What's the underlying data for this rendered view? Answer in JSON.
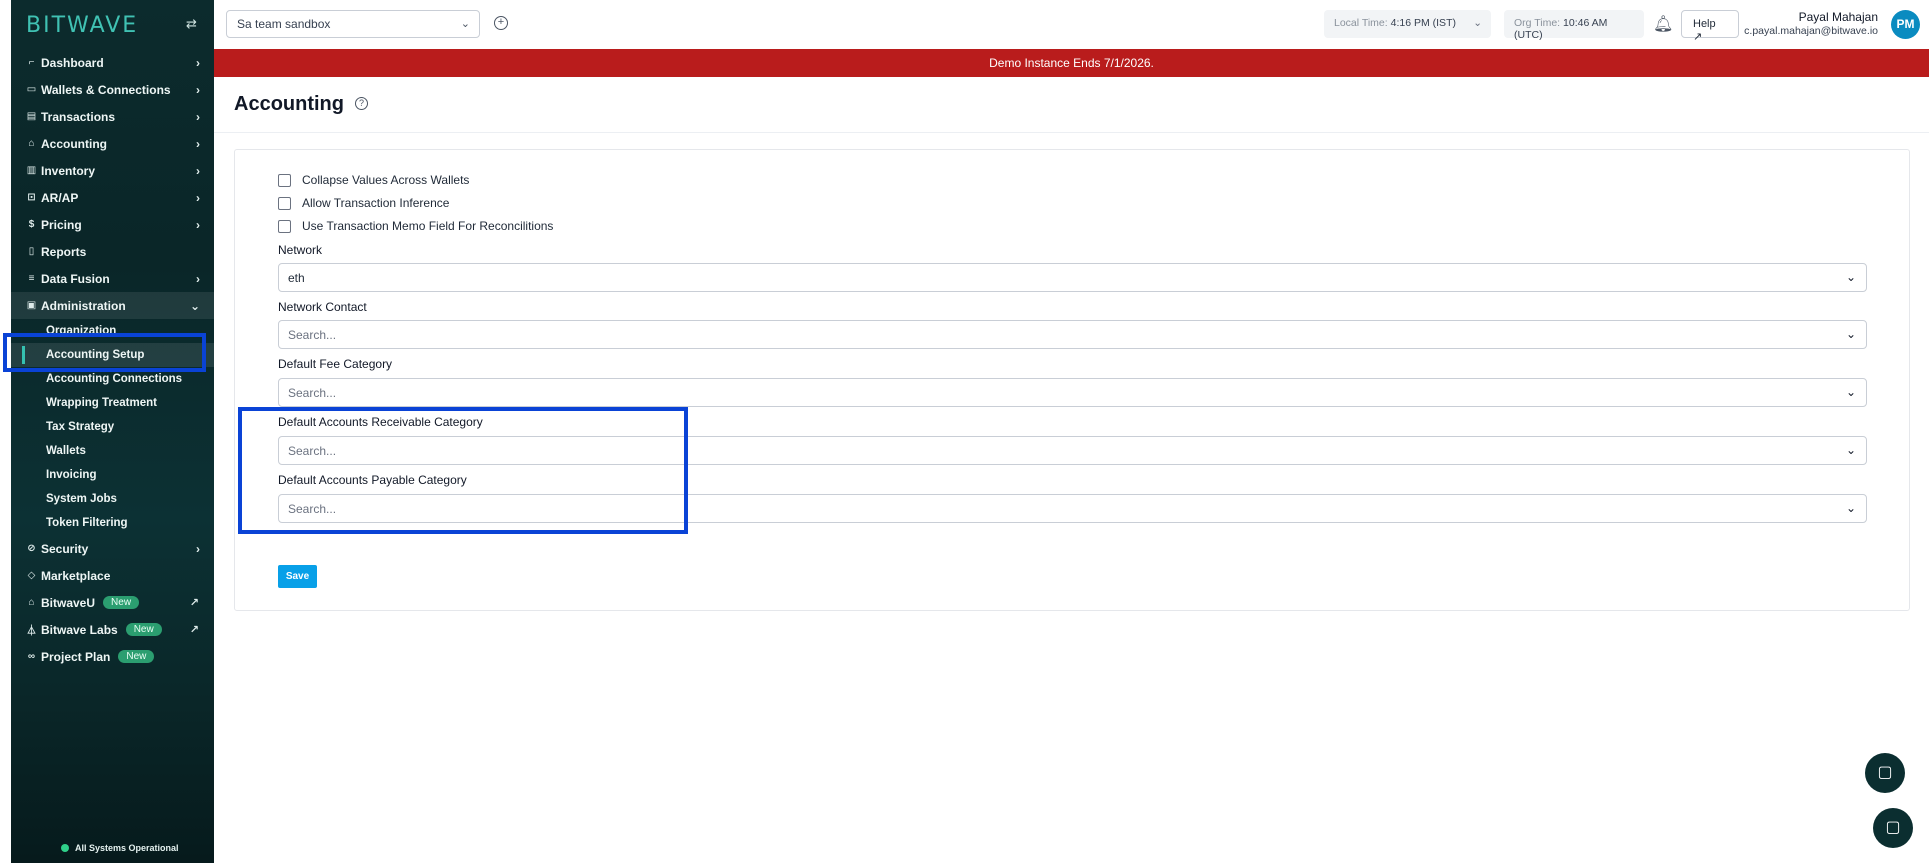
{
  "sidebar": {
    "brand": "BITWAVE",
    "items": [
      {
        "label": "Dashboard",
        "icon": "chart-line-icon",
        "glyph": "⌐"
      },
      {
        "label": "Wallets & Connections",
        "icon": "wallet-icon",
        "glyph": "▭"
      },
      {
        "label": "Transactions",
        "icon": "transactions-icon",
        "glyph": "▤"
      },
      {
        "label": "Accounting",
        "icon": "bank-icon",
        "glyph": "⌂"
      },
      {
        "label": "Inventory",
        "icon": "inventory-icon",
        "glyph": "▥"
      },
      {
        "label": "AR/AP",
        "icon": "invoice-icon",
        "glyph": "⊡"
      },
      {
        "label": "Pricing",
        "icon": "dollar-icon",
        "glyph": "$"
      },
      {
        "label": "Reports",
        "icon": "report-icon",
        "glyph": "▯"
      },
      {
        "label": "Data Fusion",
        "icon": "database-icon",
        "glyph": "≡"
      },
      {
        "label": "Administration",
        "icon": "admin-icon",
        "glyph": "▣"
      }
    ],
    "admin_sub": [
      "Organization",
      "Accounting Setup",
      "Accounting Connections",
      "Wrapping Treatment",
      "Tax Strategy",
      "Wallets",
      "Invoicing",
      "System Jobs",
      "Token Filtering"
    ],
    "bottom_items": [
      {
        "label": "Security",
        "icon": "shield-icon",
        "glyph": "⊘"
      },
      {
        "label": "Marketplace",
        "icon": "tag-icon",
        "glyph": "◇"
      },
      {
        "label": "BitwaveU",
        "icon": "graduation-cap-icon",
        "glyph": "⌂",
        "badge": "New"
      },
      {
        "label": "Bitwave Labs",
        "icon": "flask-icon",
        "glyph": "⏃",
        "badge": "New"
      },
      {
        "label": "Project Plan",
        "icon": "binoculars-icon",
        "glyph": "∞",
        "badge": "New"
      }
    ],
    "status": "All Systems Operational"
  },
  "topbar": {
    "org": "Sa team sandbox",
    "local_time_label": "Local Time:",
    "local_time": "4:16 PM (IST)",
    "org_time_label": "Org Time:",
    "org_time": "10:46 AM (UTC)",
    "help": "Help",
    "user_name": "Payal Mahajan",
    "user_email": "c.payal.mahajan@bitwave.io",
    "avatar": "PM"
  },
  "banner": "Demo Instance Ends 7/1/2026.",
  "page": {
    "title": "Accounting",
    "checkboxes": [
      "Collapse Values Across Wallets",
      "Allow Transaction Inference",
      "Use Transaction Memo Field For Reconcilitions"
    ],
    "fields": [
      {
        "label": "Network",
        "value": "eth"
      },
      {
        "label": "Network Contact",
        "placeholder": "Search..."
      },
      {
        "label": "Default Fee Category",
        "placeholder": "Search..."
      },
      {
        "label": "Default Accounts Receivable Category",
        "placeholder": "Search..."
      },
      {
        "label": "Default Accounts Payable Category",
        "placeholder": "Search..."
      }
    ],
    "save": "Save"
  },
  "colors": {
    "sidebar_bg": "#0c2b2d",
    "brand": "#40c2b3",
    "banner": "#b91c1c",
    "save_button": "#08a0e8",
    "highlight": "#0a43d6",
    "avatar": "#0a8bc0"
  }
}
